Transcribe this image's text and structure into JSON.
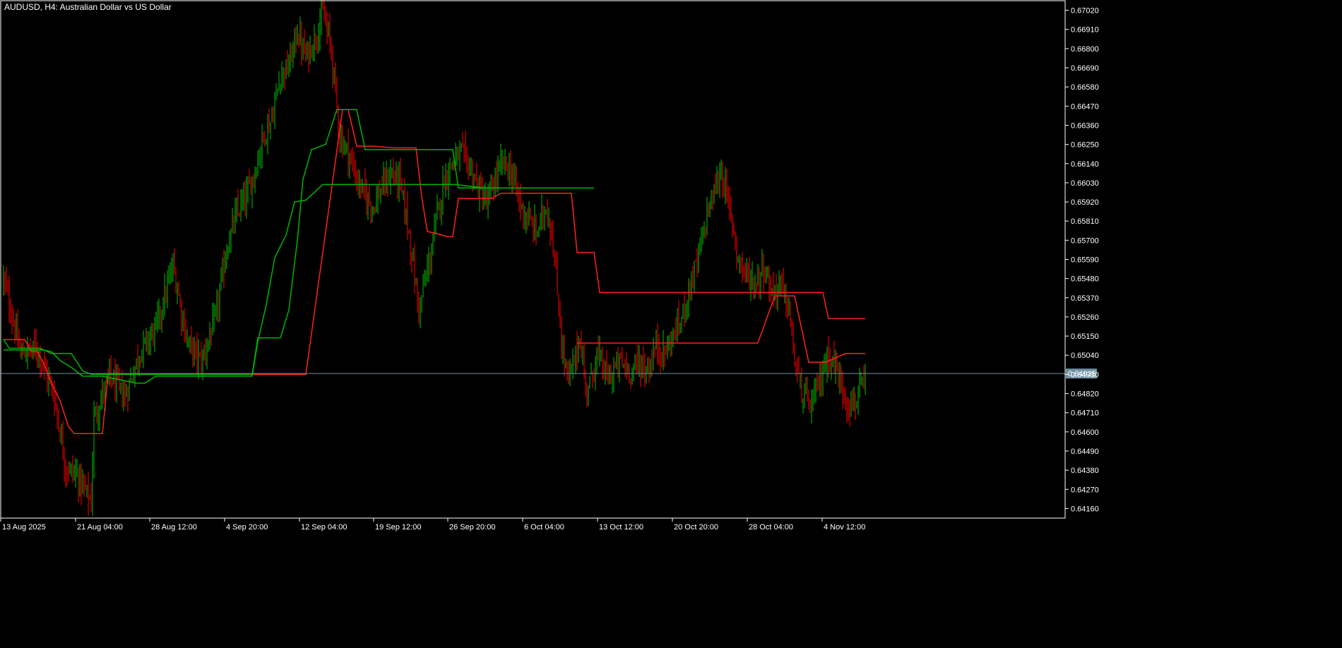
{
  "window": {
    "title": "AUDUSD, H4:  Australian Dollar vs US Dollar"
  },
  "colors": {
    "background": "#000000",
    "frame": "#ffffff",
    "axis_text": "#ffffff",
    "bull_candle": "#00c000",
    "bear_candle": "#ff0000",
    "upper_channel": "#ff2020",
    "lower_channel": "#00b400",
    "bid_line": "#6f8fa3",
    "price_label_bg": "#6f8fa3"
  },
  "current_price_label": "0.64935",
  "chart_data": {
    "type": "line",
    "title": "AUDUSD, H4:  Australian Dollar vs US Dollar",
    "xlabel": "",
    "ylabel": "",
    "ylim": [
      0.64105,
      0.67075
    ],
    "y_ticks": [
      "0.67020",
      "0.66910",
      "0.66800",
      "0.66690",
      "0.66580",
      "0.66470",
      "0.66360",
      "0.66250",
      "0.66140",
      "0.66030",
      "0.65920",
      "0.65810",
      "0.65700",
      "0.65590",
      "0.65480",
      "0.65370",
      "0.65260",
      "0.65150",
      "0.65040",
      "0.64930",
      "0.64820",
      "0.64710",
      "0.64600",
      "0.64490",
      "0.64380",
      "0.64270",
      "0.64160"
    ],
    "x_ticks": [
      "13 Aug 2025",
      "21 Aug 04:00",
      "28 Aug 12:00",
      "4 Sep 20:00",
      "12 Sep 04:00",
      "19 Sep 12:00",
      "26 Sep 20:00",
      "6 Oct 04:00",
      "13 Oct 12:00",
      "20 Oct 20:00",
      "28 Oct 04:00",
      "4 Nov 12:00"
    ],
    "bar_count": 290,
    "candles_close_approx": [
      [
        0,
        0.6548
      ],
      [
        12,
        0.6505
      ],
      [
        24,
        0.6508
      ],
      [
        36,
        0.648
      ],
      [
        44,
        0.644
      ],
      [
        52,
        0.6435
      ],
      [
        62,
        0.642
      ],
      [
        64,
        0.6468
      ],
      [
        75,
        0.6492
      ],
      [
        86,
        0.648
      ],
      [
        96,
        0.6505
      ],
      [
        108,
        0.652
      ],
      [
        120,
        0.6555
      ],
      [
        130,
        0.6512
      ],
      [
        140,
        0.65
      ],
      [
        150,
        0.6525
      ],
      [
        158,
        0.6565
      ],
      [
        165,
        0.6585
      ],
      [
        172,
        0.6595
      ],
      [
        178,
        0.661
      ],
      [
        184,
        0.663
      ],
      [
        190,
        0.664
      ],
      [
        196,
        0.6665
      ],
      [
        202,
        0.667
      ],
      [
        208,
        0.669
      ],
      [
        214,
        0.6675
      ],
      [
        220,
        0.6685
      ],
      [
        226,
        0.67
      ],
      [
        232,
        0.668
      ],
      [
        238,
        0.663
      ],
      [
        244,
        0.662
      ],
      [
        250,
        0.6605
      ],
      [
        256,
        0.6595
      ],
      [
        262,
        0.659
      ],
      [
        268,
        0.66
      ],
      [
        274,
        0.6608
      ],
      [
        280,
        0.6605
      ],
      [
        286,
        0.658
      ],
      [
        290,
        0.6555
      ],
      [
        294,
        0.653
      ],
      [
        298,
        0.6545
      ],
      [
        302,
        0.656
      ],
      [
        306,
        0.658
      ],
      [
        312,
        0.6605
      ],
      [
        318,
        0.6615
      ],
      [
        324,
        0.662
      ],
      [
        330,
        0.6612
      ],
      [
        336,
        0.66
      ],
      [
        342,
        0.659
      ],
      [
        348,
        0.6605
      ],
      [
        354,
        0.6615
      ],
      [
        360,
        0.6608
      ],
      [
        366,
        0.659
      ],
      [
        372,
        0.658
      ],
      [
        378,
        0.6575
      ],
      [
        384,
        0.659
      ],
      [
        388,
        0.6575
      ],
      [
        392,
        0.654
      ],
      [
        396,
        0.6505
      ],
      [
        400,
        0.649
      ],
      [
        404,
        0.65
      ],
      [
        408,
        0.6515
      ],
      [
        412,
        0.6485
      ],
      [
        416,
        0.649
      ],
      [
        420,
        0.6505
      ],
      [
        428,
        0.649
      ],
      [
        436,
        0.65
      ],
      [
        444,
        0.6495
      ],
      [
        450,
        0.65
      ],
      [
        456,
        0.6495
      ],
      [
        462,
        0.651
      ],
      [
        468,
        0.6505
      ],
      [
        474,
        0.6515
      ],
      [
        480,
        0.6525
      ],
      [
        486,
        0.6545
      ],
      [
        492,
        0.656
      ],
      [
        498,
        0.6585
      ],
      [
        504,
        0.66
      ],
      [
        508,
        0.661
      ],
      [
        512,
        0.6595
      ],
      [
        516,
        0.658
      ],
      [
        520,
        0.656
      ],
      [
        526,
        0.655
      ],
      [
        532,
        0.6545
      ],
      [
        538,
        0.6555
      ],
      [
        544,
        0.654
      ],
      [
        550,
        0.6545
      ],
      [
        556,
        0.653
      ],
      [
        560,
        0.65
      ],
      [
        566,
        0.648
      ],
      [
        572,
        0.6475
      ],
      [
        578,
        0.649
      ],
      [
        584,
        0.6505
      ],
      [
        590,
        0.6495
      ],
      [
        596,
        0.648
      ],
      [
        600,
        0.6475
      ],
      [
        604,
        0.648
      ],
      [
        610,
        0.6487
      ]
    ],
    "series": [
      {
        "name": "",
        "color": "#ff2020",
        "points": [
          [
            0,
            0.6513
          ],
          [
            15,
            0.6513
          ],
          [
            20,
            0.6506
          ],
          [
            24,
            0.6506
          ],
          [
            28,
            0.65
          ],
          [
            35,
            0.6486
          ],
          [
            40,
            0.6478
          ],
          [
            46,
            0.6463
          ],
          [
            50,
            0.6459
          ],
          [
            65,
            0.6459
          ],
          [
            70,
            0.6459
          ],
          [
            74,
            0.6493
          ],
          [
            108,
            0.6493
          ],
          [
            128,
            0.6493
          ],
          [
            158,
            0.6493
          ],
          [
            172,
            0.6493
          ],
          [
            196,
            0.6493
          ],
          [
            210,
            0.6493
          ],
          [
            214,
            0.6493
          ],
          [
            240,
            0.6645
          ],
          [
            244,
            0.6645
          ],
          [
            250,
            0.6624
          ],
          [
            262,
            0.6624
          ],
          [
            276,
            0.6623
          ],
          [
            286,
            0.6623
          ],
          [
            292,
            0.6623
          ],
          [
            296,
            0.6595
          ],
          [
            300,
            0.6575
          ],
          [
            306,
            0.6574
          ],
          [
            314,
            0.6572
          ],
          [
            318,
            0.6572
          ],
          [
            322,
            0.6594
          ],
          [
            332,
            0.6594
          ],
          [
            346,
            0.6594
          ],
          [
            352,
            0.6597
          ],
          [
            362,
            0.6597
          ],
          [
            382,
            0.6597
          ],
          [
            398,
            0.6597
          ],
          [
            402,
            0.6597
          ],
          [
            406,
            0.6563
          ],
          [
            418,
            0.6563
          ],
          [
            422,
            0.654
          ],
          [
            476,
            0.654
          ],
          [
            520,
            0.654
          ],
          [
            552,
            0.654
          ],
          [
            580,
            0.654
          ],
          [
            584,
            0.6525
          ],
          [
            610,
            0.6525
          ]
        ],
        "upper_segment_2": [
          [
            406,
            0.6511
          ],
          [
            476,
            0.6511
          ],
          [
            500,
            0.6511
          ],
          [
            520,
            0.6511
          ],
          [
            534,
            0.6511
          ],
          [
            546,
            0.6538
          ],
          [
            560,
            0.6538
          ],
          [
            570,
            0.65
          ],
          [
            582,
            0.65
          ],
          [
            596,
            0.6505
          ],
          [
            610,
            0.6505
          ]
        ]
      },
      {
        "name": "",
        "color": "#00b400",
        "points": [
          [
            0,
            0.6513
          ],
          [
            4,
            0.6508
          ],
          [
            26,
            0.6508
          ],
          [
            34,
            0.6505
          ],
          [
            48,
            0.6505
          ],
          [
            56,
            0.6495
          ],
          [
            62,
            0.6493
          ],
          [
            96,
            0.6493
          ],
          [
            108,
            0.6493
          ],
          [
            140,
            0.6493
          ],
          [
            160,
            0.6493
          ],
          [
            170,
            0.6493
          ],
          [
            176,
            0.6493
          ],
          [
            180,
            0.6514
          ],
          [
            190,
            0.6514
          ],
          [
            196,
            0.6514
          ],
          [
            202,
            0.653
          ],
          [
            208,
            0.657
          ],
          [
            212,
            0.6605
          ],
          [
            218,
            0.6622
          ],
          [
            228,
            0.6625
          ],
          [
            236,
            0.6645
          ],
          [
            244,
            0.6645
          ],
          [
            250,
            0.6645
          ],
          [
            256,
            0.6622
          ],
          [
            266,
            0.6622
          ],
          [
            286,
            0.6622
          ],
          [
            300,
            0.6622
          ],
          [
            310,
            0.6622
          ],
          [
            318,
            0.6622
          ],
          [
            322,
            0.66
          ],
          [
            352,
            0.66
          ],
          [
            362,
            0.66
          ],
          [
            380,
            0.66
          ],
          [
            392,
            0.66
          ],
          [
            398,
            0.66
          ],
          [
            408,
            0.66
          ],
          [
            414,
            0.66
          ],
          [
            418,
            0.66
          ]
        ],
        "lower_segment_2": [
          [
            0,
            0.6507
          ],
          [
            20,
            0.6507
          ],
          [
            28,
            0.6507
          ],
          [
            34,
            0.6506
          ],
          [
            40,
            0.6501
          ],
          [
            48,
            0.6497
          ],
          [
            56,
            0.6492
          ],
          [
            70,
            0.6492
          ],
          [
            94,
            0.6488
          ],
          [
            100,
            0.6488
          ],
          [
            108,
            0.6492
          ],
          [
            112,
            0.6492
          ],
          [
            120,
            0.6492
          ],
          [
            140,
            0.6492
          ],
          [
            152,
            0.6492
          ],
          [
            160,
            0.6492
          ],
          [
            172,
            0.6492
          ],
          [
            176,
            0.6492
          ],
          [
            180,
            0.6512
          ],
          [
            186,
            0.6533
          ],
          [
            192,
            0.656
          ],
          [
            200,
            0.6573
          ],
          [
            206,
            0.6592
          ],
          [
            214,
            0.6593
          ],
          [
            226,
            0.6602
          ],
          [
            238,
            0.6602
          ],
          [
            250,
            0.6602
          ],
          [
            280,
            0.6602
          ],
          [
            300,
            0.6602
          ],
          [
            320,
            0.6602
          ],
          [
            340,
            0.66
          ],
          [
            360,
            0.66
          ],
          [
            380,
            0.66
          ],
          [
            400,
            0.66
          ],
          [
            418,
            0.66
          ]
        ]
      }
    ]
  }
}
